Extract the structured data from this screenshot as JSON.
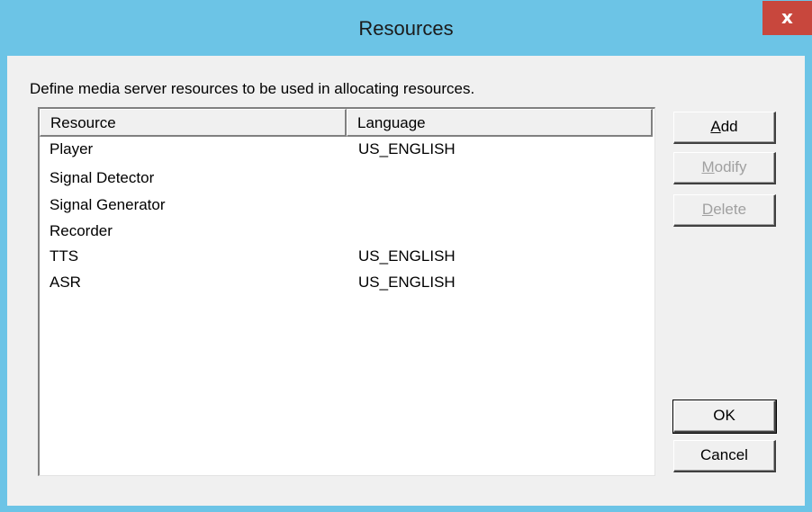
{
  "window": {
    "title": "Resources",
    "close_label": "x"
  },
  "description": "Define media server resources to be used in allocating resources.",
  "table": {
    "columns": [
      "Resource",
      "Language"
    ],
    "rows": [
      {
        "resource": "Player",
        "language": "US_ENGLISH"
      },
      {
        "resource": "Signal Detector",
        "language": ""
      },
      {
        "resource": "Signal Generator",
        "language": ""
      },
      {
        "resource": "Recorder",
        "language": ""
      },
      {
        "resource": "TTS",
        "language": "US_ENGLISH"
      },
      {
        "resource": "ASR",
        "language": "US_ENGLISH"
      }
    ]
  },
  "buttons": {
    "add": {
      "label": "Add",
      "accel": "A",
      "enabled": true
    },
    "modify": {
      "label": "Modify",
      "accel": "M",
      "enabled": false
    },
    "delete": {
      "label": "Delete",
      "accel": "D",
      "enabled": false
    },
    "ok": {
      "label": "OK",
      "enabled": true
    },
    "cancel": {
      "label": "Cancel",
      "enabled": true
    }
  },
  "colors": {
    "titlebar": "#6cc4e6",
    "close_button": "#c8473d",
    "dialog_background": "#f0f0f0",
    "disabled_text": "#a0a0a0"
  }
}
